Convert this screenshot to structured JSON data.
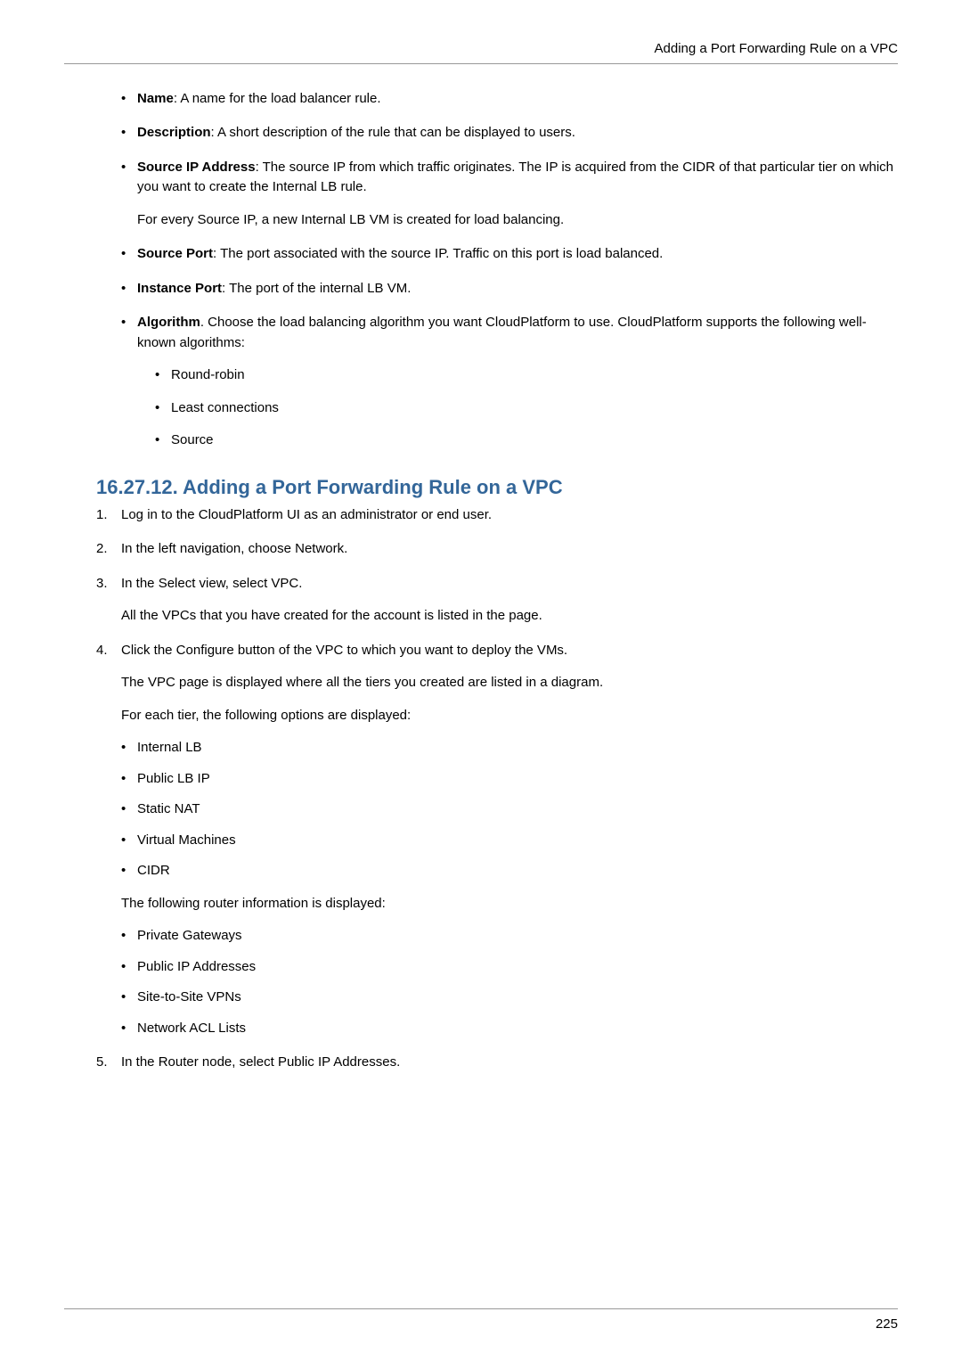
{
  "header": {
    "running_title": "Adding a Port Forwarding Rule on a VPC"
  },
  "defs": [
    {
      "term": "Name",
      "text": ": A name for the load balancer rule."
    },
    {
      "term": "Description",
      "text": ": A short description of the rule that can be displayed to users."
    },
    {
      "term": "Source IP Address",
      "text": ": The source IP from which traffic originates. The IP is acquired from the CIDR of that particular tier on which you want to create the Internal LB rule.",
      "extra": "For every Source IP, a new Internal LB VM is created for load balancing."
    },
    {
      "term": "Source Port",
      "text": ": The port associated with the source IP. Traffic on this port is load balanced."
    },
    {
      "term": "Instance Port",
      "text": ": The port of the internal LB VM."
    },
    {
      "term": "Algorithm",
      "text": ". Choose the load balancing algorithm you want CloudPlatform to use. CloudPlatform supports the following well-known algorithms:",
      "subitems": [
        "Round-robin",
        "Least connections",
        "Source"
      ]
    }
  ],
  "section": {
    "heading": "16.27.12. Adding a Port Forwarding Rule on a VPC",
    "steps": [
      {
        "text": "Log in to the CloudPlatform UI as an administrator or end user."
      },
      {
        "text": "In the left navigation, choose Network."
      },
      {
        "text": "In the Select view, select VPC.",
        "paras": [
          "All the VPCs that you have created for the account is listed in the page."
        ]
      },
      {
        "text": "Click the Configure button of the VPC to which you want to deploy the VMs.",
        "paras": [
          "The VPC page is displayed where all the tiers you created are listed in a diagram.",
          "For each tier, the following options are displayed:"
        ],
        "list1": [
          "Internal LB",
          "Public LB IP",
          "Static NAT",
          "Virtual Machines",
          "CIDR"
        ],
        "mid_para": "The following router information is displayed:",
        "list2": [
          "Private Gateways",
          "Public IP Addresses",
          "Site-to-Site VPNs",
          "Network ACL Lists"
        ]
      },
      {
        "text": "In the Router node, select Public IP Addresses."
      }
    ]
  },
  "footer": {
    "page_number": "225"
  }
}
